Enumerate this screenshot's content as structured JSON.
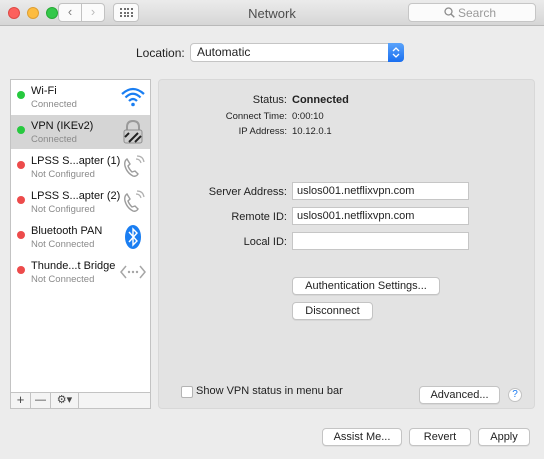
{
  "window": {
    "title": "Network",
    "search_placeholder": "Search",
    "nav_back": "‹",
    "nav_forward": "›"
  },
  "location": {
    "label": "Location:",
    "value": "Automatic"
  },
  "services": [
    {
      "name": "Wi-Fi",
      "status": "Connected",
      "status_color": "green",
      "icon": "wifi-icon"
    },
    {
      "name": "VPN (IKEv2)",
      "status": "Connected",
      "status_color": "green",
      "icon": "vpn-lock-icon",
      "selected": true
    },
    {
      "name": "LPSS S...apter (1)",
      "status": "Not Configured",
      "status_color": "red",
      "icon": "phone-icon"
    },
    {
      "name": "LPSS S...apter (2)",
      "status": "Not Configured",
      "status_color": "red",
      "icon": "phone-icon"
    },
    {
      "name": "Bluetooth PAN",
      "status": "Not Connected",
      "status_color": "red",
      "icon": "bluetooth-icon"
    },
    {
      "name": "Thunde...t Bridge",
      "status": "Not Connected",
      "status_color": "red",
      "icon": "thunderbolt-bridge-icon"
    }
  ],
  "sidebar_toolbar": {
    "add": "+",
    "remove": "—",
    "gear": "⚙▾"
  },
  "detail": {
    "status_label": "Status:",
    "status_value": "Connected",
    "connect_time_label": "Connect Time:",
    "connect_time_value": "0:00:10",
    "ip_label": "IP Address:",
    "ip_value": "10.12.0.1",
    "server_label": "Server Address:",
    "server_value": "uslos001.netflixvpn.com",
    "remote_label": "Remote ID:",
    "remote_value": "uslos001.netflixvpn.com",
    "local_label": "Local ID:",
    "local_value": "",
    "auth_button": "Authentication Settings...",
    "disconnect_button": "Disconnect",
    "show_status_label": "Show VPN status in menu bar",
    "show_status_checked": false,
    "advanced_button": "Advanced...",
    "help": "?"
  },
  "footer": {
    "assist": "Assist Me...",
    "revert": "Revert",
    "apply": "Apply"
  },
  "colors": {
    "accent": "#1a6ff0",
    "connected": "#27c93f",
    "disconnected": "#ed4b4b"
  }
}
